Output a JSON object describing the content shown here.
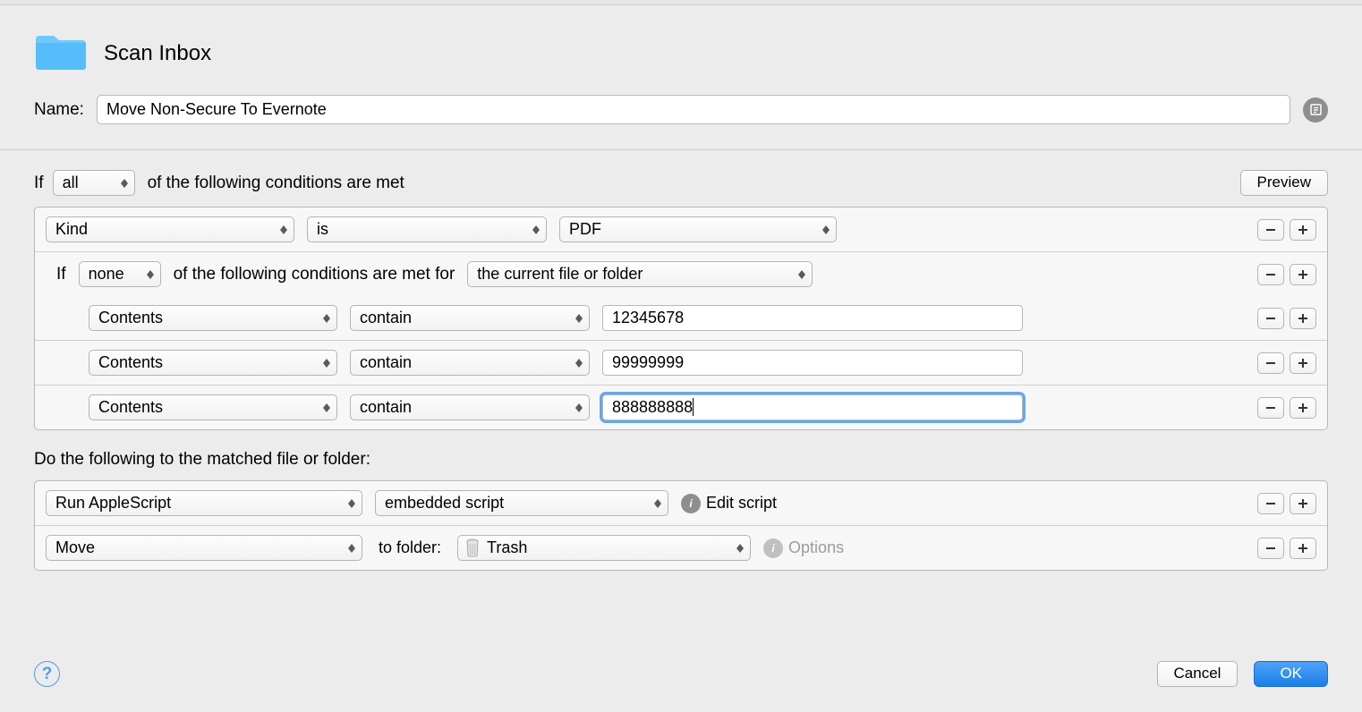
{
  "header": {
    "folder_title": "Scan Inbox"
  },
  "name": {
    "label": "Name:",
    "value": "Move Non-Secure To Evernote"
  },
  "conditions": {
    "prefix": "If",
    "match_mode": "all",
    "suffix": "of the following conditions are met",
    "preview_label": "Preview",
    "rows": [
      {
        "attr": "Kind",
        "op": "is",
        "val": "PDF"
      }
    ],
    "nested": {
      "prefix": "If",
      "mode": "none",
      "middle": "of the following conditions are met for",
      "scope": "the current file or folder",
      "rows": [
        {
          "attr": "Contents",
          "op": "contain",
          "val": "12345678"
        },
        {
          "attr": "Contents",
          "op": "contain",
          "val": "99999999"
        },
        {
          "attr": "Contents",
          "op": "contain",
          "val": "888888888",
          "focused": true
        }
      ]
    }
  },
  "actions": {
    "intro": "Do the following to the matched file or folder:",
    "rows": [
      {
        "action": "Run AppleScript",
        "param_select": "embedded script",
        "link_label": "Edit script"
      },
      {
        "action": "Move",
        "to_label": "to folder:",
        "dest": "Trash",
        "link_label": "Options",
        "dim": true
      }
    ]
  },
  "footer": {
    "cancel": "Cancel",
    "ok": "OK"
  }
}
